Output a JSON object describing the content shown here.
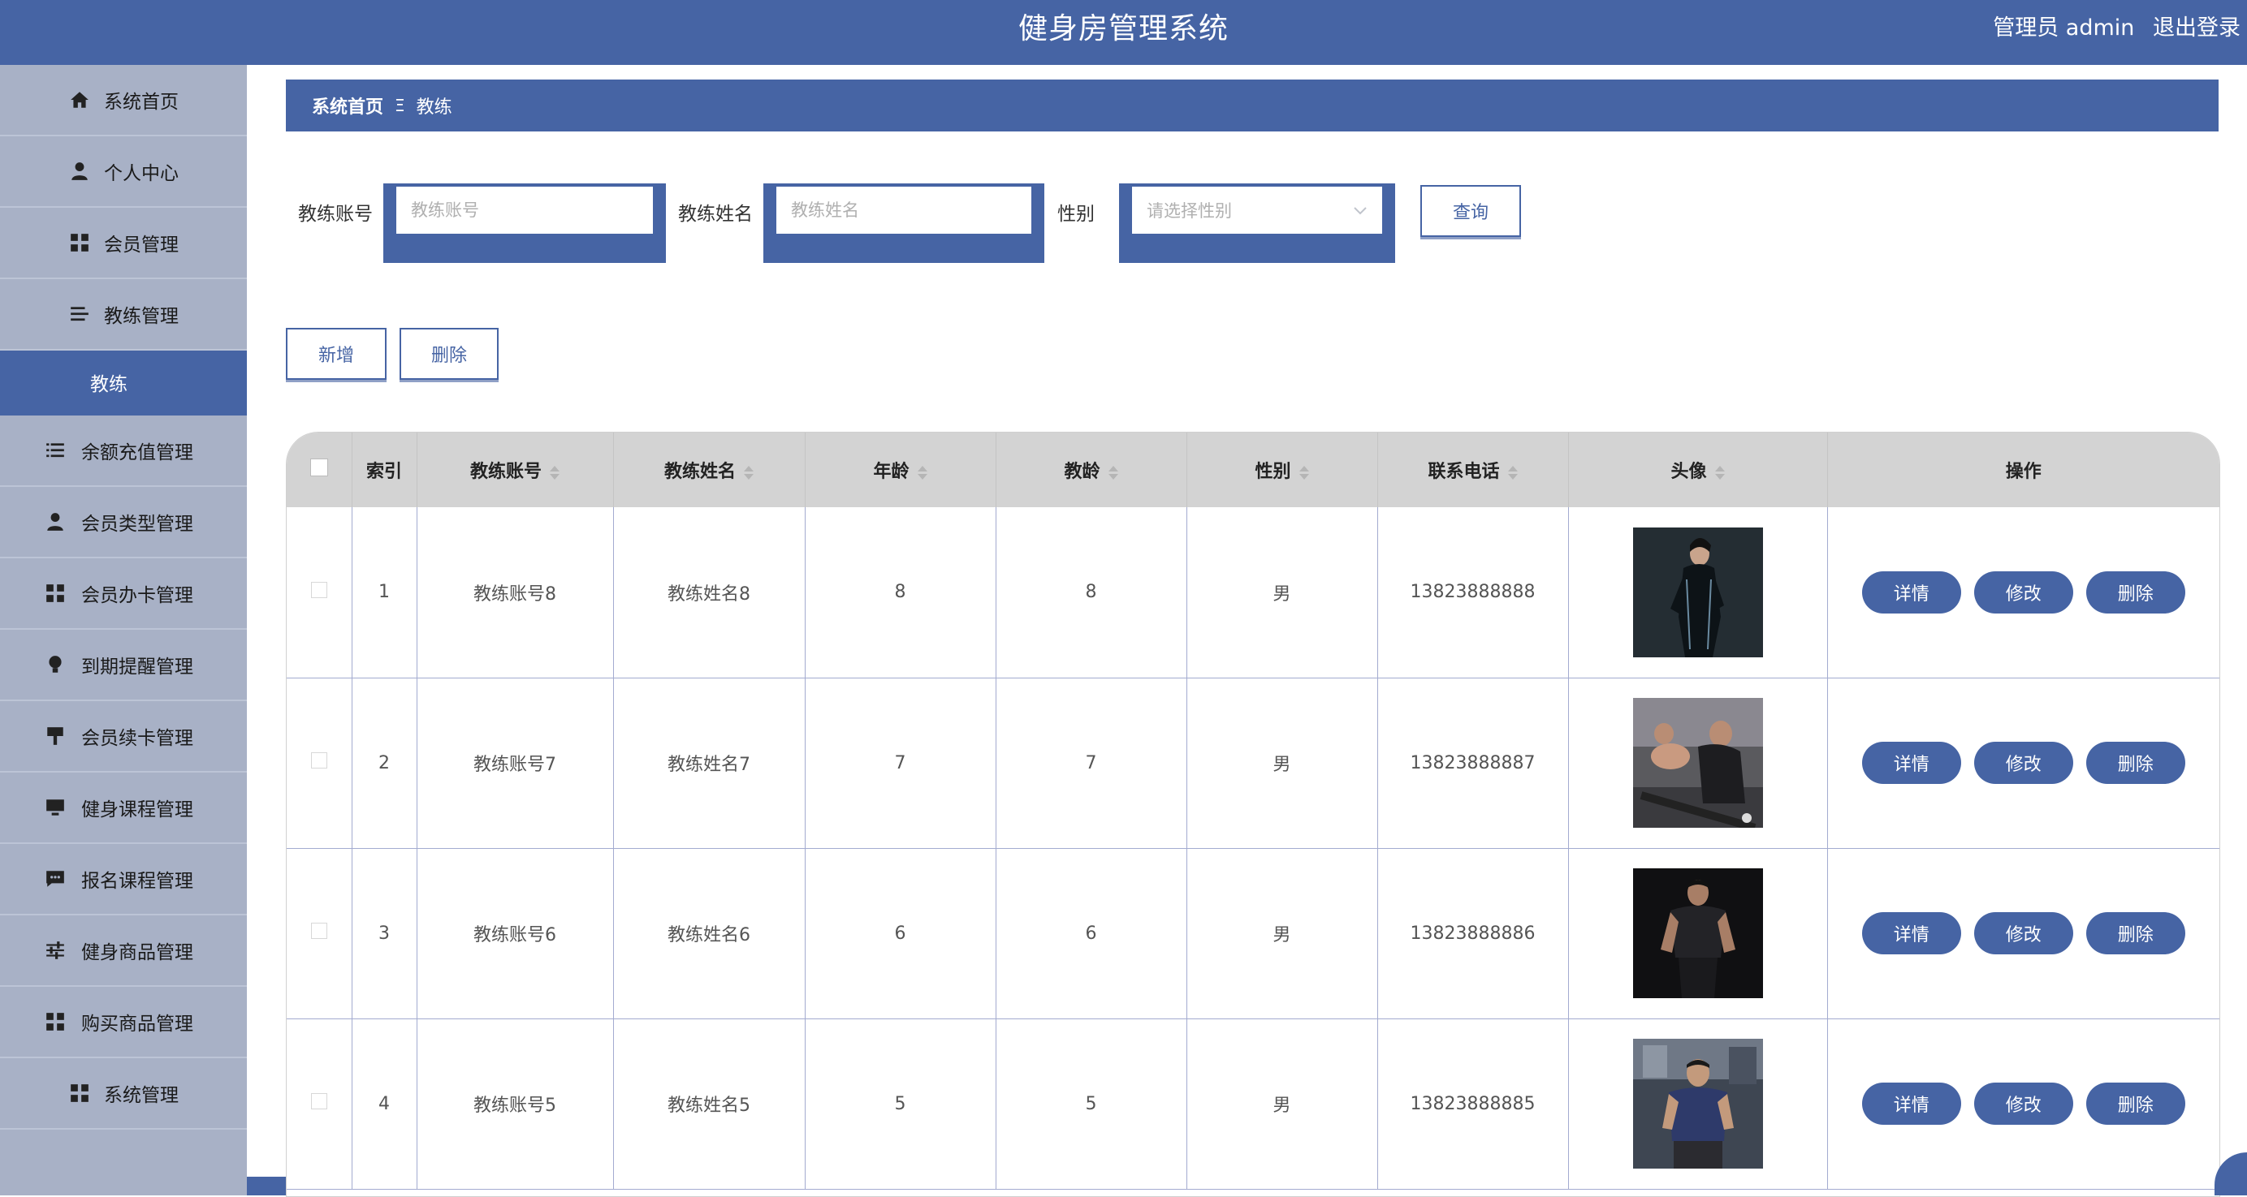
{
  "header": {
    "title": "健身房管理系统",
    "user_label": "管理员 admin",
    "logout_label": "退出登录"
  },
  "sidebar": {
    "items": [
      {
        "label": "系统首页",
        "icon": "home-icon"
      },
      {
        "label": "个人中心",
        "icon": "person-icon"
      },
      {
        "label": "会员管理",
        "icon": "grid-icon"
      },
      {
        "label": "教练管理",
        "icon": "list-icon"
      },
      {
        "label": "教练",
        "icon": "",
        "active": true
      },
      {
        "label": "余额充值管理",
        "icon": "list-icon"
      },
      {
        "label": "会员类型管理",
        "icon": "person-icon"
      },
      {
        "label": "会员办卡管理",
        "icon": "grid-icon"
      },
      {
        "label": "到期提醒管理",
        "icon": "bulb-icon"
      },
      {
        "label": "会员续卡管理",
        "icon": "stamp-icon"
      },
      {
        "label": "健身课程管理",
        "icon": "monitor-icon"
      },
      {
        "label": "报名课程管理",
        "icon": "chat-icon"
      },
      {
        "label": "健身商品管理",
        "icon": "sliders-icon"
      },
      {
        "label": "购买商品管理",
        "icon": "grid-icon"
      },
      {
        "label": "系统管理",
        "icon": "grid-icon"
      }
    ]
  },
  "breadcrumb": {
    "home": "系统首页",
    "separator": "Ξ",
    "current": "教练"
  },
  "search": {
    "account_label": "教练账号",
    "account_placeholder": "教练账号",
    "name_label": "教练姓名",
    "name_placeholder": "教练姓名",
    "gender_label": "性别",
    "gender_placeholder": "请选择性别",
    "query_label": "查询"
  },
  "actions": {
    "add_label": "新增",
    "delete_label": "删除"
  },
  "table": {
    "headers": [
      "索引",
      "教练账号",
      "教练姓名",
      "年龄",
      "教龄",
      "性别",
      "联系电话",
      "头像",
      "操作"
    ],
    "rows": [
      {
        "index": "1",
        "account": "教练账号8",
        "name": "教练姓名8",
        "age": "8",
        "years": "8",
        "gender": "男",
        "phone": "13823888888"
      },
      {
        "index": "2",
        "account": "教练账号7",
        "name": "教练姓名7",
        "age": "7",
        "years": "7",
        "gender": "男",
        "phone": "13823888887"
      },
      {
        "index": "3",
        "account": "教练账号6",
        "name": "教练姓名6",
        "age": "6",
        "years": "6",
        "gender": "男",
        "phone": "13823888886"
      },
      {
        "index": "4",
        "account": "教练账号5",
        "name": "教练姓名5",
        "age": "5",
        "years": "5",
        "gender": "男",
        "phone": "13823888885"
      }
    ],
    "op_labels": {
      "detail": "详情",
      "edit": "修改",
      "delete": "删除"
    }
  },
  "colors": {
    "primary": "#4664a4",
    "sidebar_bg": "#a8b1c6",
    "header_row_bg": "#d3d3d3"
  }
}
